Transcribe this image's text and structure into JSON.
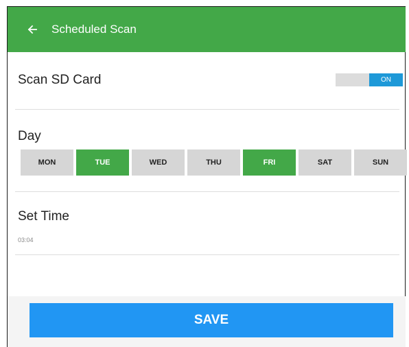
{
  "app_bar": {
    "title": "Scheduled Scan",
    "back_icon": "arrow-left-icon"
  },
  "scan_sd_card": {
    "label": "Scan SD Card",
    "toggle_state": "ON"
  },
  "day_section": {
    "label": "Day",
    "days": [
      {
        "label": "MON",
        "selected": false
      },
      {
        "label": "TUE",
        "selected": true
      },
      {
        "label": "WED",
        "selected": false
      },
      {
        "label": "THU",
        "selected": false
      },
      {
        "label": "FRI",
        "selected": true
      },
      {
        "label": "SAT",
        "selected": false
      },
      {
        "label": "SUN",
        "selected": false
      }
    ]
  },
  "set_time": {
    "label": "Set Time",
    "value": "03:04"
  },
  "save_button": {
    "label": "SAVE"
  },
  "colors": {
    "toolbar": "#43a848",
    "day_selected": "#43a848",
    "toggle_on": "#1e99d8",
    "save_button": "#2196f3"
  }
}
